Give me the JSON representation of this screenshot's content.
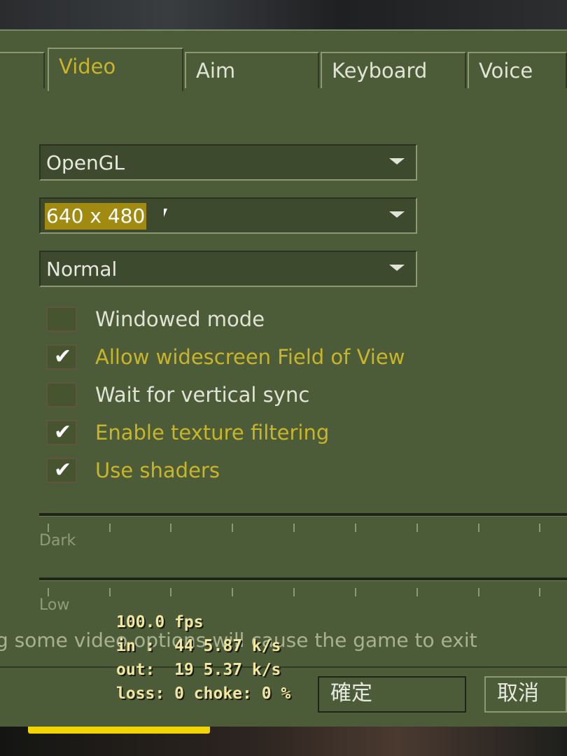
{
  "tabs": [
    {
      "label": ""
    },
    {
      "label": "Video",
      "active": true
    },
    {
      "label": "Aim"
    },
    {
      "label": "Keyboard"
    },
    {
      "label": "Voice"
    }
  ],
  "video": {
    "renderer": "OpenGL",
    "resolution": "640 x 480",
    "quality": "Normal",
    "options": [
      {
        "label": "Windowed mode",
        "checked": false
      },
      {
        "label": "Allow widescreen Field of View",
        "checked": true
      },
      {
        "label": "Wait for vertical sync",
        "checked": false
      },
      {
        "label": "Enable texture filtering",
        "checked": true
      },
      {
        "label": "Use shaders",
        "checked": true
      }
    ],
    "slider1_label": "Dark",
    "slider2_label": "Low",
    "check_glyph": "✔"
  },
  "warning": "g some video options will cause the game to exit",
  "buttons": {
    "ok": "確定",
    "cancel": "取消"
  },
  "netgraph": {
    "fps": "100.0 fps",
    "in": "in :  44 5.87 k/s",
    "out": "out:  19 5.37 k/s",
    "loss": "loss: 0 choke: 0 %"
  },
  "colors": {
    "panel": "#4c5c38",
    "active_text": "#c9b52a",
    "text": "#dfe4d5"
  }
}
